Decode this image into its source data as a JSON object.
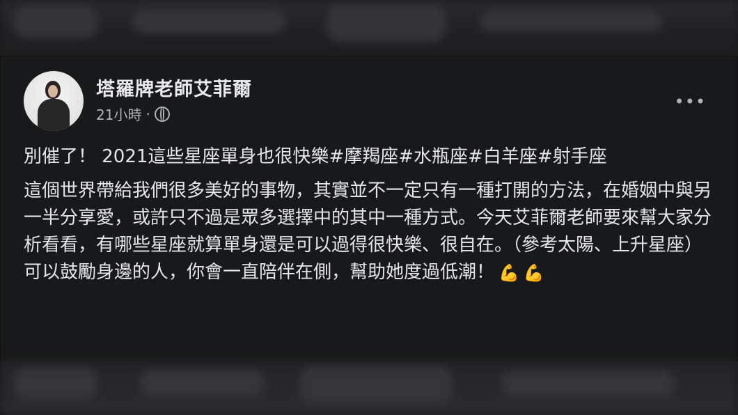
{
  "post": {
    "author": "塔羅牌老師艾菲爾",
    "time": "21小時",
    "separator": "·",
    "title_text": "別催了！ 2021這些星座單身也很快樂",
    "hashtags": [
      "#摩羯座",
      "#水瓶座",
      "#白羊座",
      "#射手座"
    ],
    "body_text": "這個世界帶給我們很多美好的事物，其實並不一定只有一種打開的方法，在婚姻中與另一半分享愛，或許只不過是眾多選擇中的其中一種方式。今天艾菲爾老師要來幫大家分析看看，有哪些星座就算單身還是可以過得很快樂、很自在。（參考太陽、上升星座）可以鼓勵身邊的人，你會一直陪伴在側，幫助她度過低潮！",
    "emoji_1": "💪",
    "emoji_2": "💪"
  },
  "icons": {
    "more": "more-options-icon",
    "globe": "globe-icon",
    "muscle": "flexed-biceps-icon"
  },
  "colors": {
    "background": "#18191a",
    "text_primary": "#e4e6eb",
    "text_secondary": "#b0b3b8",
    "emoji_yellow": "#f1c232"
  }
}
